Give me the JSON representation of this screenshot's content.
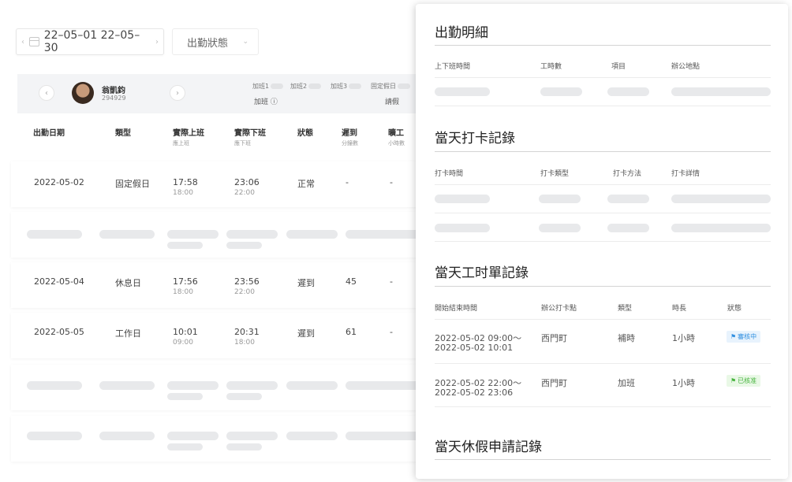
{
  "filter": {
    "date_range": "22–05–01 22–05–30",
    "status_placeholder": "出勤狀態"
  },
  "employee": {
    "name": "翁凱鈞",
    "id": "294929",
    "ot_labels": [
      "加班1",
      "加班2",
      "加班3",
      "固定假日"
    ],
    "ot_summary_label": "加班",
    "leave_label": "請假"
  },
  "table": {
    "headers": [
      {
        "label": "出勤日期",
        "sub": ""
      },
      {
        "label": "類型",
        "sub": ""
      },
      {
        "label": "實際上班",
        "sub": "應上班"
      },
      {
        "label": "實際下班",
        "sub": "應下班"
      },
      {
        "label": "狀態",
        "sub": ""
      },
      {
        "label": "遲到",
        "sub": "分鐘數"
      },
      {
        "label": "曠工",
        "sub": "小時數"
      }
    ],
    "rows": [
      {
        "date": "2022-05-02",
        "type": "固定假日",
        "in": "17:58",
        "in_sched": "18:00",
        "out": "23:06",
        "out_sched": "22:00",
        "status": "正常",
        "late": "-",
        "absent": "-"
      },
      {
        "date": "2022-05-04",
        "type": "休息日",
        "in": "17:56",
        "in_sched": "18:00",
        "out": "23:56",
        "out_sched": "22:00",
        "status": "遲到",
        "late": "45",
        "absent": "-"
      },
      {
        "date": "2022-05-05",
        "type": "工作日",
        "in": "10:01",
        "in_sched": "09:00",
        "out": "20:31",
        "out_sched": "18:00",
        "status": "遲到",
        "late": "61",
        "absent": "-"
      }
    ]
  },
  "drawer": {
    "attendance_detail": {
      "title": "出勤明細",
      "headers": [
        "上下班時間",
        "工時數",
        "項目",
        "辦公地點"
      ]
    },
    "punch_records": {
      "title": "當天打卡記錄",
      "headers": [
        "打卡時間",
        "打卡類型",
        "打卡方法",
        "打卡詳情"
      ]
    },
    "timesheet_records": {
      "title": "當天工时單記錄",
      "headers": [
        "開始結束時間",
        "辦公打卡點",
        "類型",
        "時長",
        "狀態"
      ],
      "rows": [
        {
          "start": "2022-05-02 09:00～",
          "end": "2022-05-02 10:01",
          "location": "西門町",
          "type": "補時",
          "duration": "1小時",
          "status": "審核中"
        },
        {
          "start": "2022-05-02 22:00～",
          "end": "2022-05-02 23:06",
          "location": "西門町",
          "type": "加班",
          "duration": "1小時",
          "status": "已核准"
        }
      ]
    },
    "leave_records": {
      "title": "當天休假申請記錄"
    }
  },
  "colors": {
    "review_badge": "#2f8fe0",
    "approved_badge": "#47b43f"
  }
}
